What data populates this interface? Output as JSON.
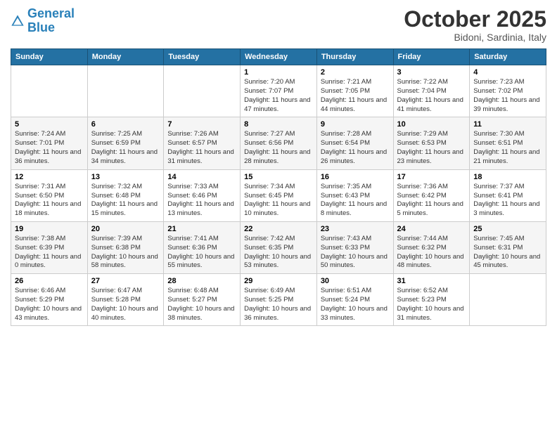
{
  "header": {
    "logo_general": "General",
    "logo_blue": "Blue",
    "title": "October 2025",
    "subtitle": "Bidoni, Sardinia, Italy"
  },
  "weekdays": [
    "Sunday",
    "Monday",
    "Tuesday",
    "Wednesday",
    "Thursday",
    "Friday",
    "Saturday"
  ],
  "weeks": [
    [
      {
        "day": "",
        "info": ""
      },
      {
        "day": "",
        "info": ""
      },
      {
        "day": "",
        "info": ""
      },
      {
        "day": "1",
        "info": "Sunrise: 7:20 AM\nSunset: 7:07 PM\nDaylight: 11 hours\nand 47 minutes."
      },
      {
        "day": "2",
        "info": "Sunrise: 7:21 AM\nSunset: 7:05 PM\nDaylight: 11 hours\nand 44 minutes."
      },
      {
        "day": "3",
        "info": "Sunrise: 7:22 AM\nSunset: 7:04 PM\nDaylight: 11 hours\nand 41 minutes."
      },
      {
        "day": "4",
        "info": "Sunrise: 7:23 AM\nSunset: 7:02 PM\nDaylight: 11 hours\nand 39 minutes."
      }
    ],
    [
      {
        "day": "5",
        "info": "Sunrise: 7:24 AM\nSunset: 7:01 PM\nDaylight: 11 hours\nand 36 minutes."
      },
      {
        "day": "6",
        "info": "Sunrise: 7:25 AM\nSunset: 6:59 PM\nDaylight: 11 hours\nand 34 minutes."
      },
      {
        "day": "7",
        "info": "Sunrise: 7:26 AM\nSunset: 6:57 PM\nDaylight: 11 hours\nand 31 minutes."
      },
      {
        "day": "8",
        "info": "Sunrise: 7:27 AM\nSunset: 6:56 PM\nDaylight: 11 hours\nand 28 minutes."
      },
      {
        "day": "9",
        "info": "Sunrise: 7:28 AM\nSunset: 6:54 PM\nDaylight: 11 hours\nand 26 minutes."
      },
      {
        "day": "10",
        "info": "Sunrise: 7:29 AM\nSunset: 6:53 PM\nDaylight: 11 hours\nand 23 minutes."
      },
      {
        "day": "11",
        "info": "Sunrise: 7:30 AM\nSunset: 6:51 PM\nDaylight: 11 hours\nand 21 minutes."
      }
    ],
    [
      {
        "day": "12",
        "info": "Sunrise: 7:31 AM\nSunset: 6:50 PM\nDaylight: 11 hours\nand 18 minutes."
      },
      {
        "day": "13",
        "info": "Sunrise: 7:32 AM\nSunset: 6:48 PM\nDaylight: 11 hours\nand 15 minutes."
      },
      {
        "day": "14",
        "info": "Sunrise: 7:33 AM\nSunset: 6:46 PM\nDaylight: 11 hours\nand 13 minutes."
      },
      {
        "day": "15",
        "info": "Sunrise: 7:34 AM\nSunset: 6:45 PM\nDaylight: 11 hours\nand 10 minutes."
      },
      {
        "day": "16",
        "info": "Sunrise: 7:35 AM\nSunset: 6:43 PM\nDaylight: 11 hours\nand 8 minutes."
      },
      {
        "day": "17",
        "info": "Sunrise: 7:36 AM\nSunset: 6:42 PM\nDaylight: 11 hours\nand 5 minutes."
      },
      {
        "day": "18",
        "info": "Sunrise: 7:37 AM\nSunset: 6:41 PM\nDaylight: 11 hours\nand 3 minutes."
      }
    ],
    [
      {
        "day": "19",
        "info": "Sunrise: 7:38 AM\nSunset: 6:39 PM\nDaylight: 11 hours\nand 0 minutes."
      },
      {
        "day": "20",
        "info": "Sunrise: 7:39 AM\nSunset: 6:38 PM\nDaylight: 10 hours\nand 58 minutes."
      },
      {
        "day": "21",
        "info": "Sunrise: 7:41 AM\nSunset: 6:36 PM\nDaylight: 10 hours\nand 55 minutes."
      },
      {
        "day": "22",
        "info": "Sunrise: 7:42 AM\nSunset: 6:35 PM\nDaylight: 10 hours\nand 53 minutes."
      },
      {
        "day": "23",
        "info": "Sunrise: 7:43 AM\nSunset: 6:33 PM\nDaylight: 10 hours\nand 50 minutes."
      },
      {
        "day": "24",
        "info": "Sunrise: 7:44 AM\nSunset: 6:32 PM\nDaylight: 10 hours\nand 48 minutes."
      },
      {
        "day": "25",
        "info": "Sunrise: 7:45 AM\nSunset: 6:31 PM\nDaylight: 10 hours\nand 45 minutes."
      }
    ],
    [
      {
        "day": "26",
        "info": "Sunrise: 6:46 AM\nSunset: 5:29 PM\nDaylight: 10 hours\nand 43 minutes."
      },
      {
        "day": "27",
        "info": "Sunrise: 6:47 AM\nSunset: 5:28 PM\nDaylight: 10 hours\nand 40 minutes."
      },
      {
        "day": "28",
        "info": "Sunrise: 6:48 AM\nSunset: 5:27 PM\nDaylight: 10 hours\nand 38 minutes."
      },
      {
        "day": "29",
        "info": "Sunrise: 6:49 AM\nSunset: 5:25 PM\nDaylight: 10 hours\nand 36 minutes."
      },
      {
        "day": "30",
        "info": "Sunrise: 6:51 AM\nSunset: 5:24 PM\nDaylight: 10 hours\nand 33 minutes."
      },
      {
        "day": "31",
        "info": "Sunrise: 6:52 AM\nSunset: 5:23 PM\nDaylight: 10 hours\nand 31 minutes."
      },
      {
        "day": "",
        "info": ""
      }
    ]
  ]
}
